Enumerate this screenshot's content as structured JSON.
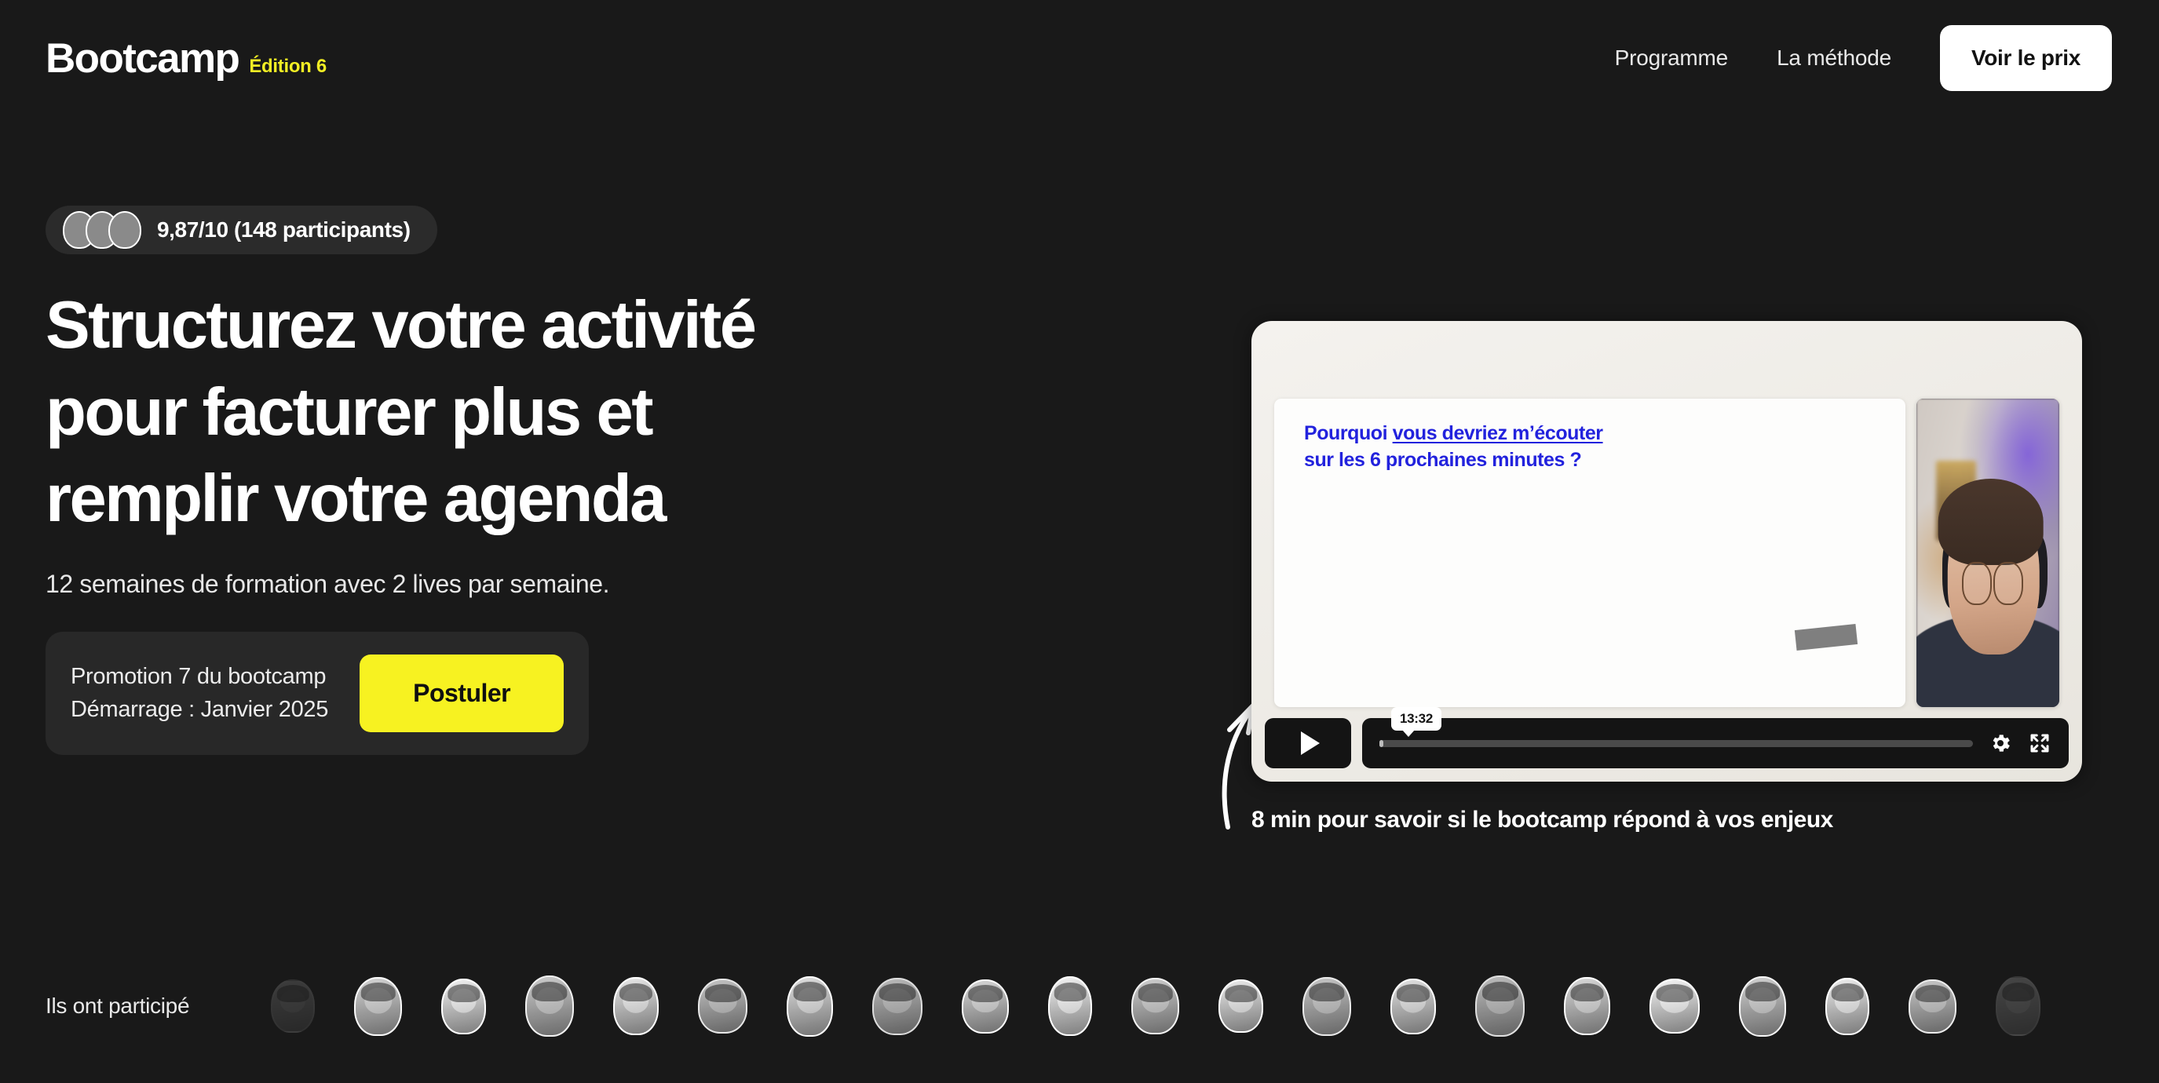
{
  "header": {
    "brand_name": "Bootcamp",
    "brand_edition": "Édition 6",
    "nav": [
      {
        "label": "Programme"
      },
      {
        "label": "La méthode"
      }
    ],
    "cta_label": "Voir le prix"
  },
  "hero": {
    "rating_text": "9,87/10 (148 participants)",
    "headline_line1": "Structurez votre activité",
    "headline_line2": "pour facturer plus et",
    "headline_line3": "remplir votre agenda",
    "subtitle": "12 semaines de formation avec 2 lives par semaine.",
    "promo": {
      "line1": "Promotion 7 du bootcamp",
      "line2": "Démarrage : Janvier 2025",
      "button_label": "Postuler"
    }
  },
  "video": {
    "slide_text_before": "Pourquoi ",
    "slide_text_underlined": "vous devriez m’écouter",
    "slide_text_after": "sur les 6 prochaines minutes ?",
    "current_time": "13:32",
    "progress_percent": 0.6,
    "caption": "8 min pour savoir si le bootcamp répond à vos enjeux",
    "play_icon": "play-icon",
    "settings_icon": "gear-icon",
    "fullscreen_icon": "fullscreen-icon"
  },
  "participants": {
    "label": "Ils ont participé",
    "count": 21
  },
  "colors": {
    "background": "#191919",
    "accent_yellow": "#f7f221",
    "edition_yellow": "#f2ee24",
    "card_surface": "#282828",
    "pill_surface": "#2b2b2b",
    "slide_blue": "#2222dd",
    "text_primary": "#ffffff"
  }
}
